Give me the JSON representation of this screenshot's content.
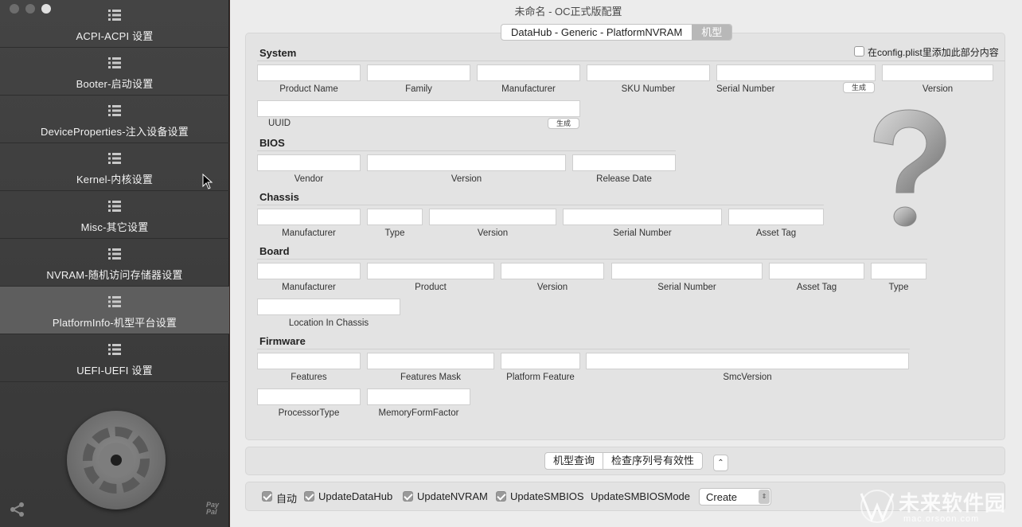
{
  "window": {
    "title": "未命名 - OC正式版配置"
  },
  "sidebar": {
    "items": [
      {
        "label": "ACPI-ACPI 设置",
        "icon": "list-icon",
        "active": false
      },
      {
        "label": "Booter-启动设置",
        "icon": "list-icon",
        "active": false
      },
      {
        "label": "DeviceProperties-注入设备设置",
        "icon": "list-icon",
        "active": false
      },
      {
        "label": "Kernel-内核设置",
        "icon": "list-icon",
        "active": false
      },
      {
        "label": "Misc-其它设置",
        "icon": "list-icon",
        "active": false
      },
      {
        "label": "NVRAM-随机访问存储器设置",
        "icon": "list-icon",
        "active": false
      },
      {
        "label": "PlatformInfo-机型平台设置",
        "icon": "list-icon",
        "active": true
      },
      {
        "label": "UEFI-UEFI 设置",
        "icon": "list-icon",
        "active": false
      }
    ],
    "paypal": "Pay\nPal"
  },
  "tabs": {
    "items": [
      "DataHub  -  Generic  -  PlatformNVRAM",
      "机型"
    ],
    "selected": 1
  },
  "system": {
    "title": "System",
    "add_checkbox_label": "在config.plist里添加此部分内容",
    "add_checked": false,
    "fields": [
      "Product Name",
      "Family",
      "Manufacturer",
      "SKU Number",
      "Serial Number",
      "Version"
    ],
    "uuid_label": "UUID",
    "generate_label": "生成"
  },
  "bios": {
    "title": "BIOS",
    "fields": [
      "Vendor",
      "Version",
      "Release Date"
    ]
  },
  "chassis": {
    "title": "Chassis",
    "fields": [
      "Manufacturer",
      "Type",
      "Version",
      "Serial Number",
      "Asset Tag"
    ]
  },
  "board": {
    "title": "Board",
    "fields": [
      "Manufacturer",
      "Product",
      "Version",
      "Serial Number",
      "Asset Tag",
      "Type",
      "Location In Chassis"
    ]
  },
  "firmware": {
    "title": "Firmware",
    "fields": [
      "Features",
      "Features Mask",
      "Platform Feature",
      "SmcVersion",
      "ProcessorType",
      "MemoryFormFactor"
    ]
  },
  "actions": {
    "lookup": "机型查询",
    "check_serial": "检查序列号有效性",
    "stepper": "⌃⌄"
  },
  "options": {
    "auto": {
      "label": "自动",
      "checked": true
    },
    "update_datahub": {
      "label": "UpdateDataHub",
      "checked": true
    },
    "update_nvram": {
      "label": "UpdateNVRAM",
      "checked": true
    },
    "update_smbios": {
      "label": "UpdateSMBIOS",
      "checked": true
    },
    "smbios_mode_label": "UpdateSMBIOSMode",
    "smbios_mode_value": "Create"
  },
  "watermark": {
    "text": "未来软件园",
    "url": "mac.orsoon.com"
  },
  "colors": {
    "sidebar_bg": "#3f3f3f",
    "sidebar_active": "#5e5e5e",
    "main_bg": "#ececec",
    "panel_bg": "#e3e3e3"
  }
}
